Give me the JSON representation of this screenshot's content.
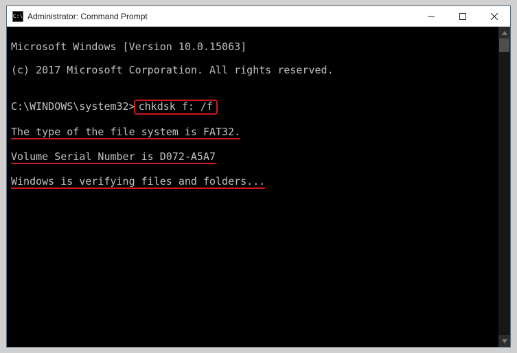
{
  "window": {
    "title": "Administrator: Command Prompt",
    "icon_label": "C:\\"
  },
  "terminal": {
    "line1": "Microsoft Windows [Version 10.0.15063]",
    "line2": "(c) 2017 Microsoft Corporation. All rights reserved.",
    "blank": "",
    "prompt_prefix": "C:\\WINDOWS\\system32>",
    "command": "chkdsk f: /f",
    "out1": "The type of the file system is FAT32.",
    "out2": "Volume Serial Number is D072-A5A7",
    "out3": "Windows is verifying files and folders..."
  }
}
